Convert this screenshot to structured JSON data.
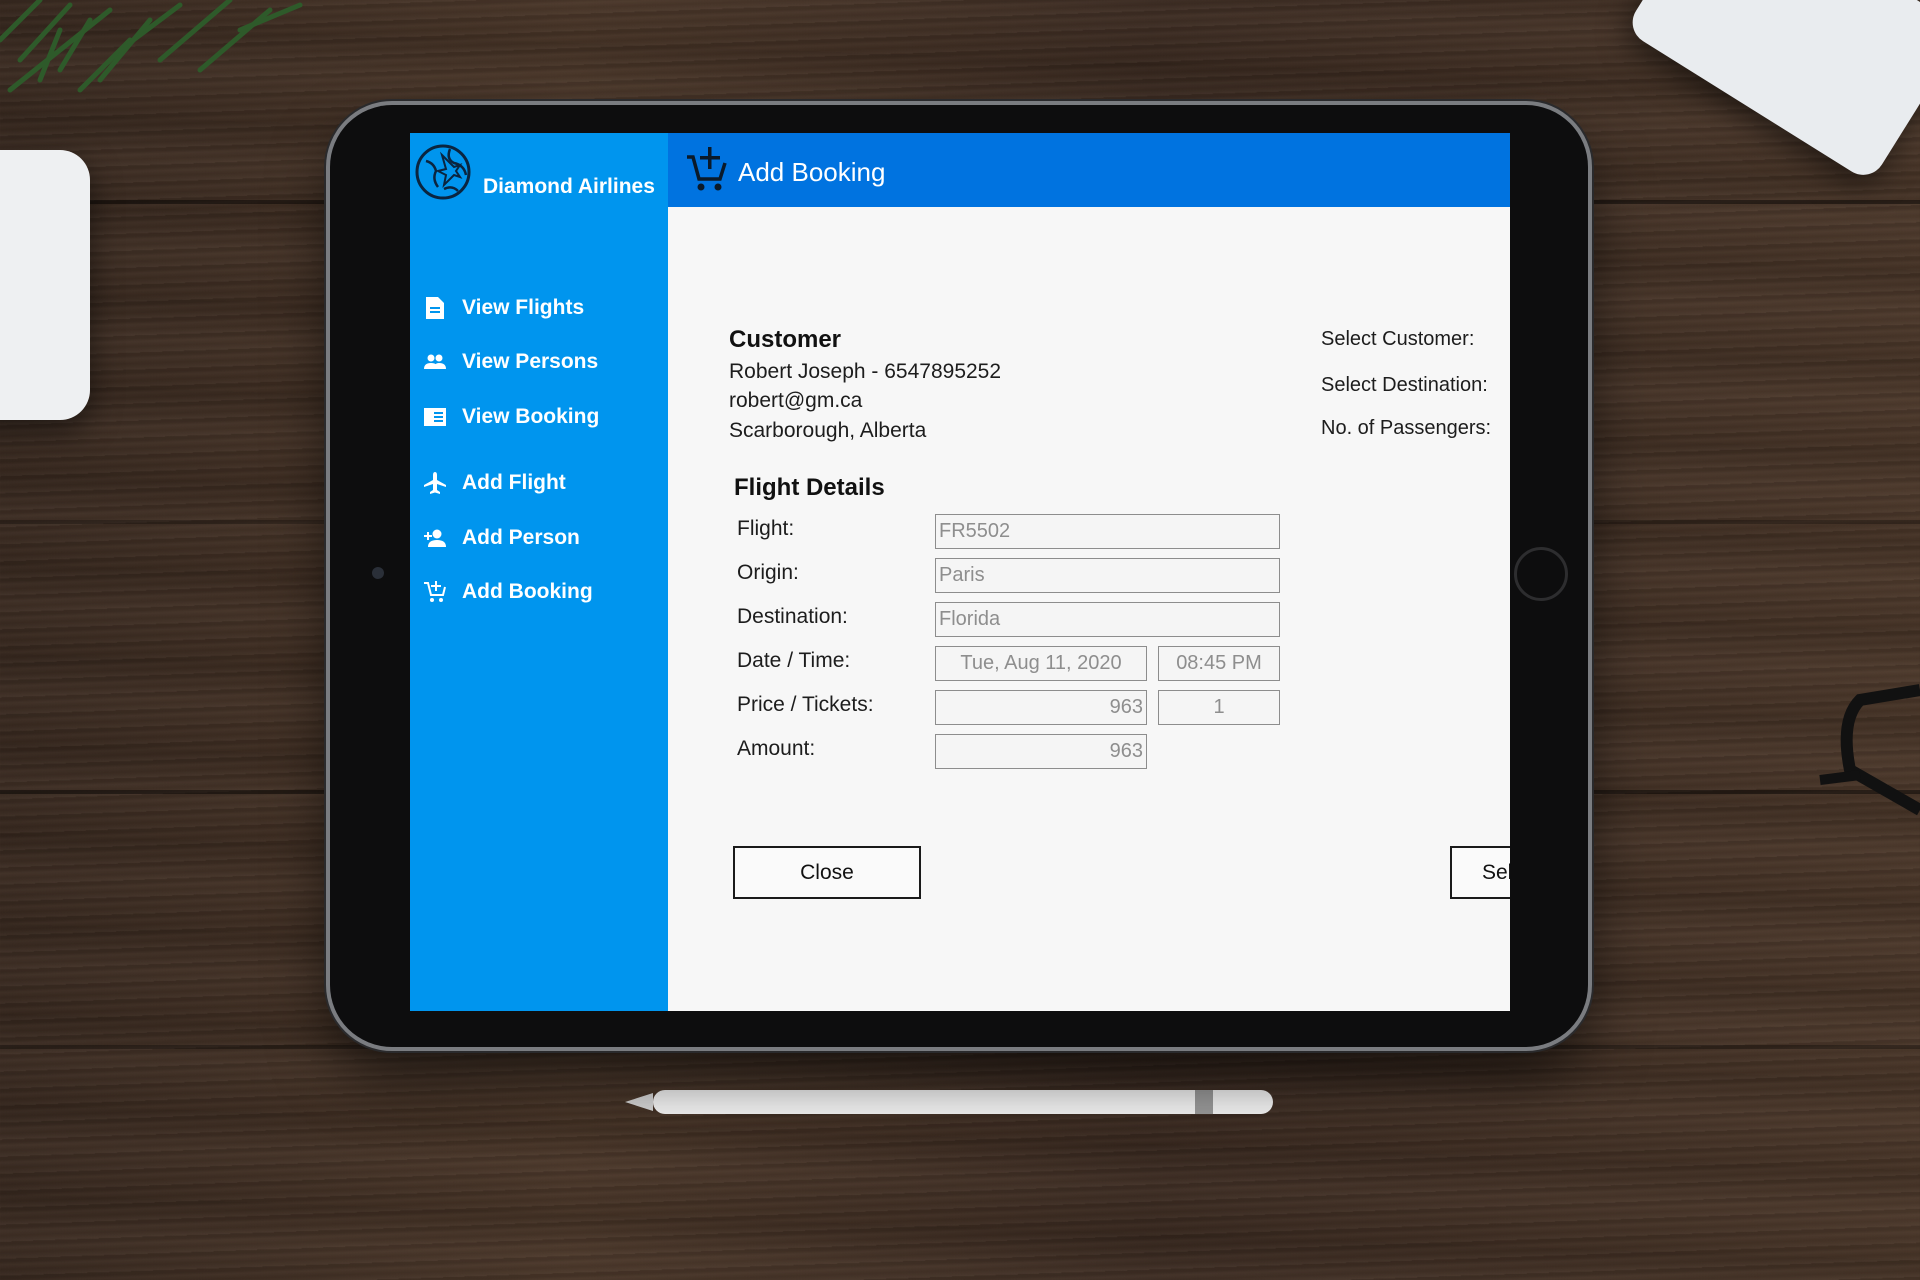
{
  "app": {
    "brand_name": "Diamond Airlines",
    "page_title": "Add Booking"
  },
  "sidebar": {
    "items": [
      {
        "label": "View Flights",
        "icon": "document-icon"
      },
      {
        "label": "View Persons",
        "icon": "people-icon"
      },
      {
        "label": "View Booking",
        "icon": "booking-list-icon"
      },
      {
        "label": "Add Flight",
        "icon": "airplane-icon"
      },
      {
        "label": "Add Person",
        "icon": "add-person-icon"
      },
      {
        "label": "Add Booking",
        "icon": "add-cart-icon"
      }
    ]
  },
  "customer": {
    "heading": "Customer",
    "name_phone": "Robert Joseph - 6547895252",
    "email": "robert@gm.ca",
    "address": "Scarborough, Alberta"
  },
  "flight": {
    "heading": "Flight Details",
    "labels": {
      "flight": "Flight:",
      "origin": "Origin:",
      "destination": "Destination:",
      "datetime": "Date / Time:",
      "price_tickets": "Price / Tickets:",
      "amount": "Amount:"
    },
    "values": {
      "flight": "FR5502",
      "origin": "Paris",
      "destination": "Florida",
      "date": "Tue, Aug 11, 2020",
      "time": "08:45 PM",
      "price": "963",
      "tickets": "1",
      "amount": "963"
    }
  },
  "selectors": {
    "customer_label": "Select Customer:",
    "destination_label": "Select Destination:",
    "passengers_label": "No. of Passengers:"
  },
  "buttons": {
    "close": "Close",
    "select_partial": "Sel"
  },
  "colors": {
    "sidebar": "#0095ee",
    "header": "#0073e0",
    "content_bg": "#f7f7f7"
  }
}
